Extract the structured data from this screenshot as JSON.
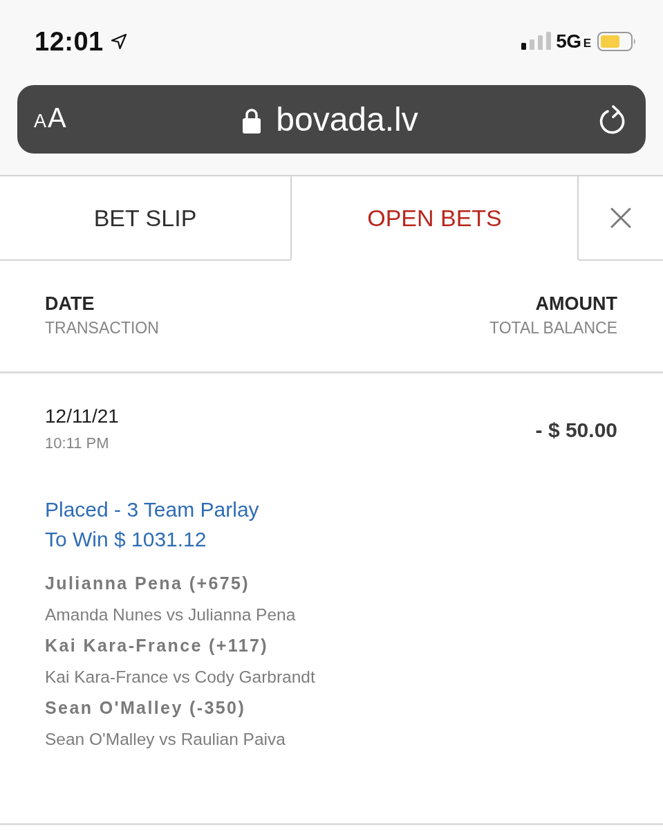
{
  "status_bar": {
    "time": "12:01",
    "network": "5G",
    "network_suffix": "E"
  },
  "address_bar": {
    "text_size_label": "AA",
    "url": "bovada.lv"
  },
  "tabs": [
    {
      "label": "BET SLIP",
      "selected": false
    },
    {
      "label": "OPEN BETS",
      "selected": true
    }
  ],
  "columns": [
    {
      "title": "DATE",
      "subtitle": "TRANSACTION"
    },
    {
      "title": "AMOUNT",
      "subtitle": "TOTAL BALANCE"
    }
  ],
  "transactions": [
    {
      "date": "12/11/21",
      "time": "10:11 PM",
      "amount": "- $ 50.00",
      "status": "Placed - 3 Team Parlay",
      "to_win": "To Win $ 1031.12",
      "selections": [
        {
          "pick": "Julianna Pena (+675)",
          "event": "Amanda Nunes vs Julianna Pena"
        },
        {
          "pick": "Kai Kara-France (+117)",
          "event": "Kai Kara-France vs Cody Garbrandt"
        },
        {
          "pick": "Sean O'Malley (-350)",
          "event": "Sean O'Malley vs Raulian Paiva"
        }
      ]
    }
  ]
}
